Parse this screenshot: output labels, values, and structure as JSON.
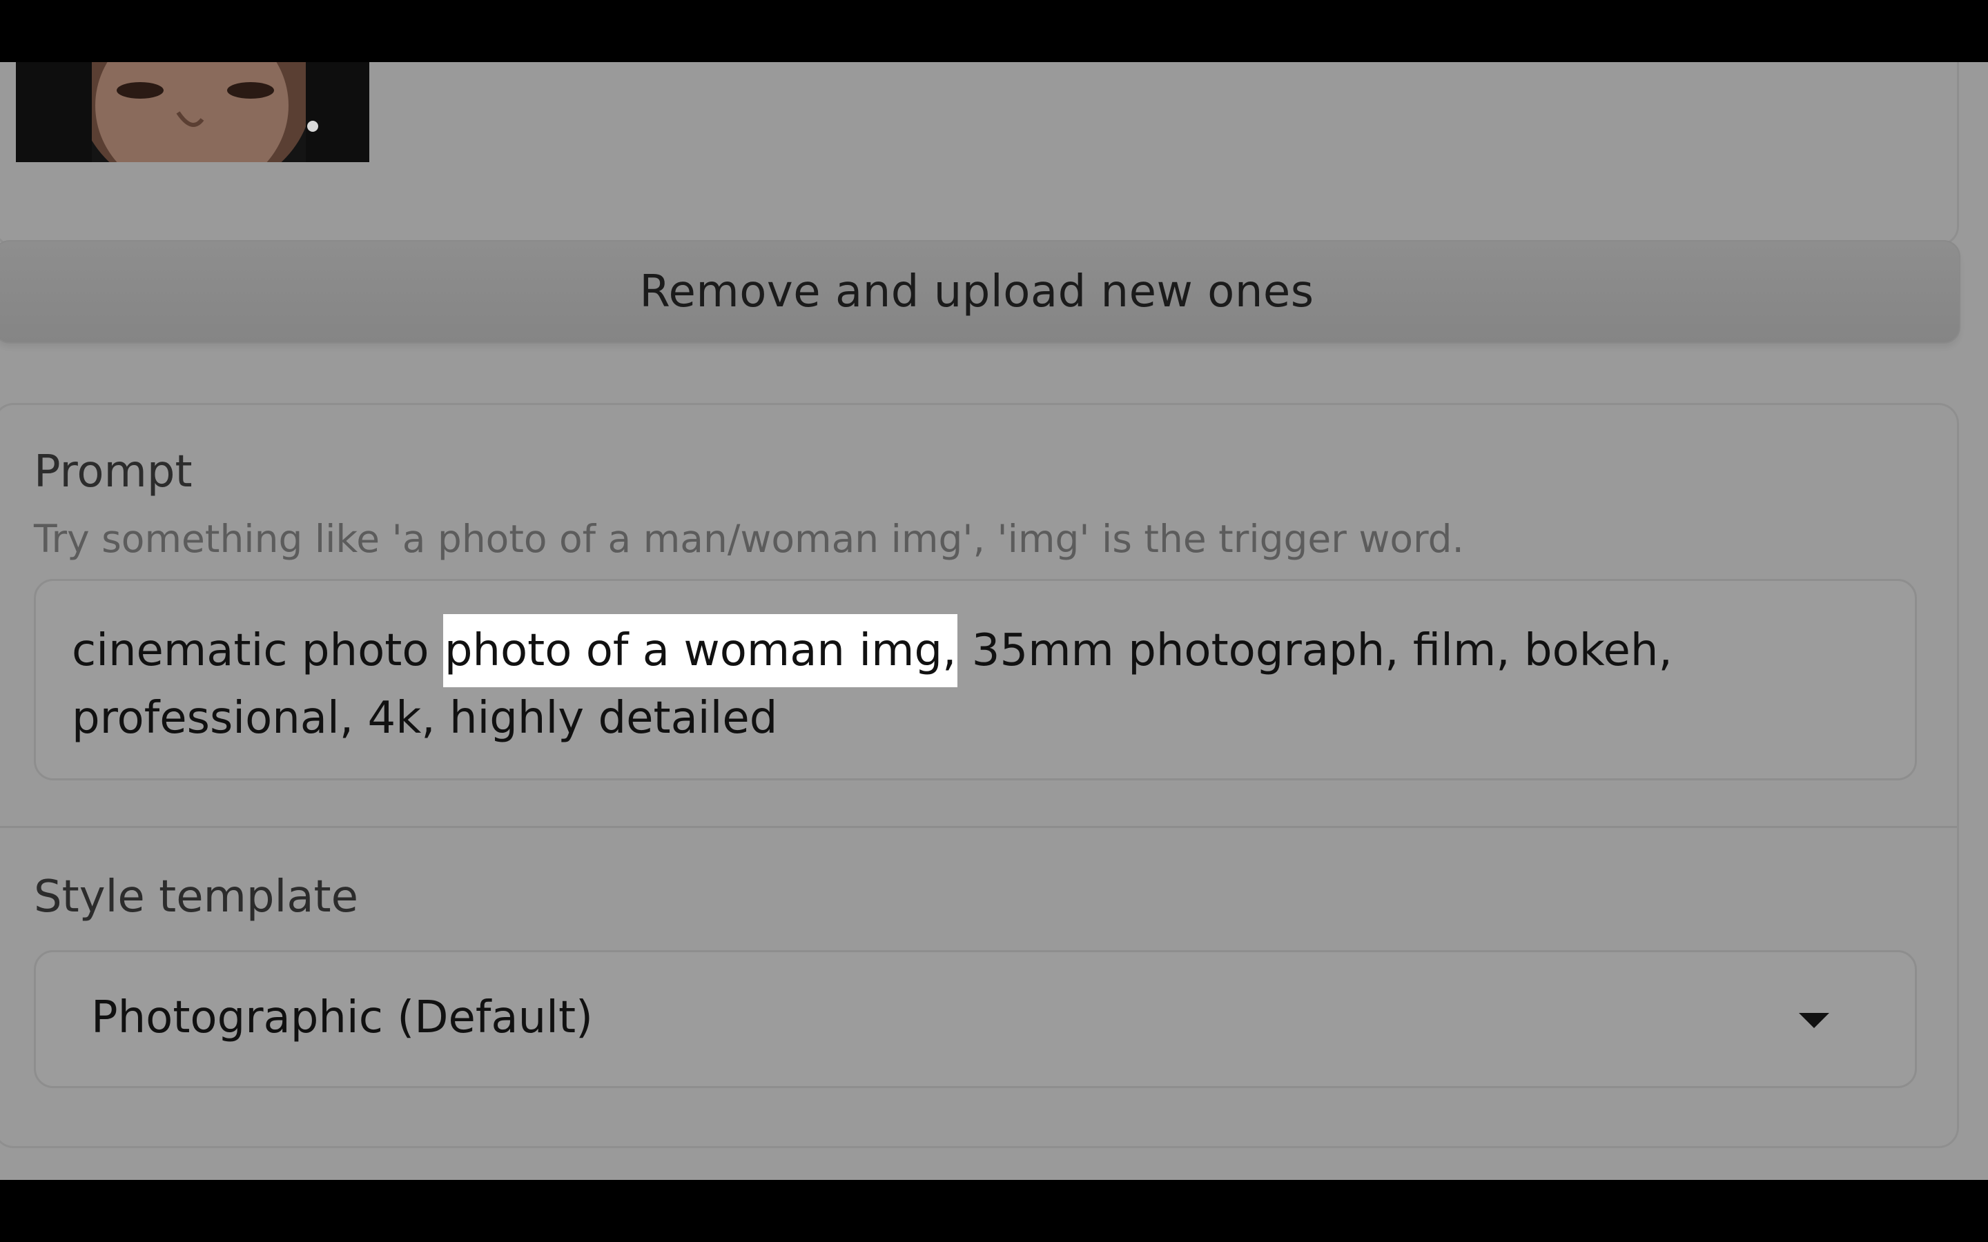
{
  "upload": {
    "remove_button_label": "Remove and upload new ones"
  },
  "prompt": {
    "label": "Prompt",
    "hint": "Try something like 'a photo of a man/woman img', 'img' is the trigger word.",
    "value_before": "cinematic photo ",
    "value_selected": "photo of a woman img,",
    "value_after": " 35mm photograph, film, bokeh, professional, 4k, highly detailed"
  },
  "style": {
    "label": "Style template",
    "selected": "Photographic (Default)"
  },
  "icons": {
    "dropdown": "chevron-down-icon",
    "thumbnail": "uploaded-portrait-image"
  },
  "colors": {
    "page_bg": "#9a9a9a",
    "selection_highlight": "#ffffff",
    "letterbox": "#000000"
  }
}
